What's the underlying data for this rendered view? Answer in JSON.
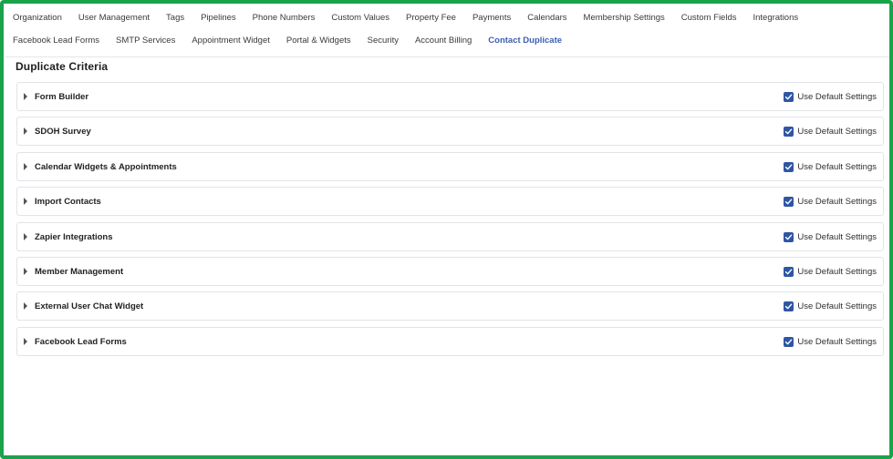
{
  "tabs": {
    "row1": [
      {
        "label": "Organization"
      },
      {
        "label": "User Management"
      },
      {
        "label": "Tags"
      },
      {
        "label": "Pipelines"
      },
      {
        "label": "Phone Numbers"
      },
      {
        "label": "Custom Values"
      },
      {
        "label": "Property Fee"
      },
      {
        "label": "Payments"
      },
      {
        "label": "Calendars"
      },
      {
        "label": "Membership Settings"
      },
      {
        "label": "Custom Fields"
      },
      {
        "label": "Integrations"
      }
    ],
    "row2": [
      {
        "label": "Facebook Lead Forms"
      },
      {
        "label": "SMTP Services"
      },
      {
        "label": "Appointment Widget"
      },
      {
        "label": "Portal & Widgets"
      },
      {
        "label": "Security"
      },
      {
        "label": "Account Billing"
      },
      {
        "label": "Contact Duplicate"
      }
    ],
    "active": "Contact Duplicate"
  },
  "section": {
    "title": "Duplicate Criteria"
  },
  "criteria": [
    {
      "label": "Form Builder",
      "checkbox_label": "Use Default Settings",
      "checked": true
    },
    {
      "label": "SDOH Survey",
      "checkbox_label": "Use Default Settings",
      "checked": true
    },
    {
      "label": "Calendar Widgets & Appointments",
      "checkbox_label": "Use Default Settings",
      "checked": true
    },
    {
      "label": "Import Contacts",
      "checkbox_label": "Use Default Settings",
      "checked": true
    },
    {
      "label": "Zapier Integrations",
      "checkbox_label": "Use Default Settings",
      "checked": true
    },
    {
      "label": "Member Management",
      "checkbox_label": "Use Default Settings",
      "checked": true
    },
    {
      "label": "External User Chat Widget",
      "checkbox_label": "Use Default Settings",
      "checked": true
    },
    {
      "label": "Facebook Lead Forms",
      "checkbox_label": "Use Default Settings",
      "checked": true
    }
  ],
  "colors": {
    "frame_border": "#1aa34a",
    "active_tab": "#3c5fb0",
    "checkbox_fill": "#2f56a3"
  },
  "icons": {
    "expand": "caret-right-icon",
    "check": "checkmark-icon"
  }
}
